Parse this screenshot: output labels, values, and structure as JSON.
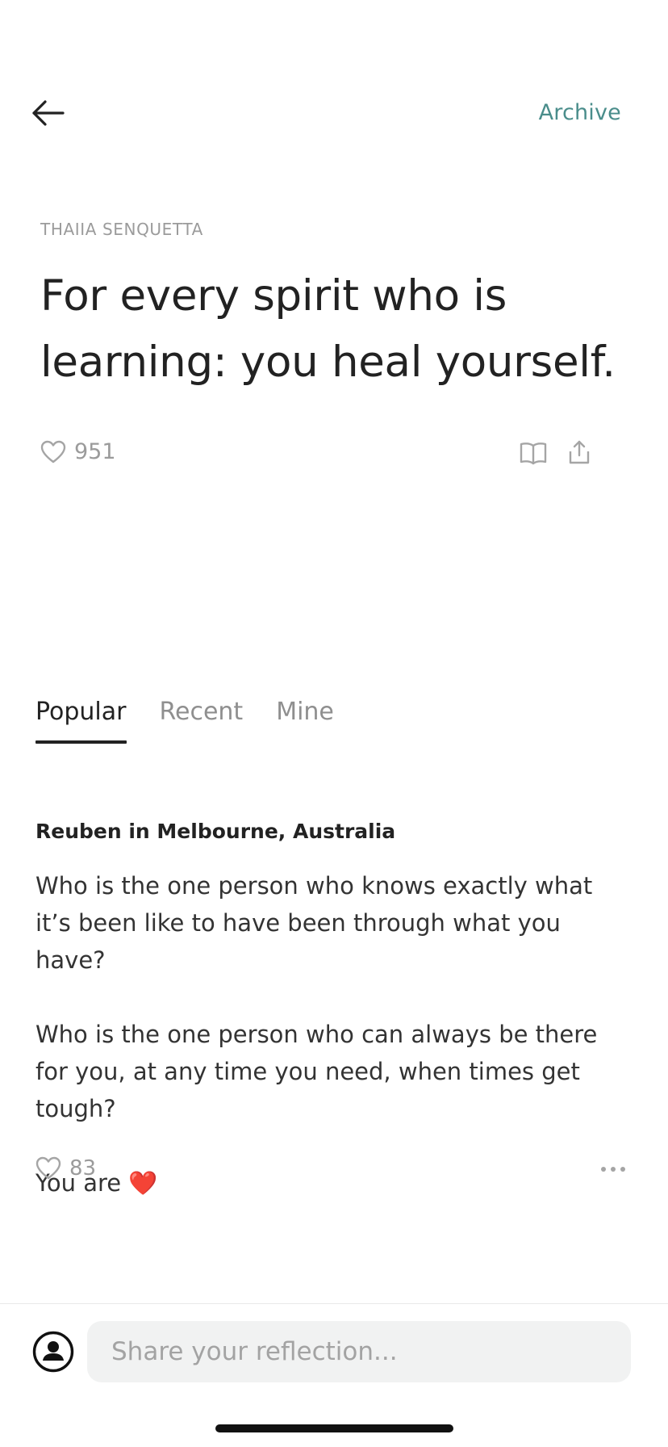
{
  "header": {
    "back_icon": "arrow-left-icon",
    "archive_label": "Archive"
  },
  "quote": {
    "author": "THAIIA SENQUETTA",
    "text": "For every spirit who is learning: you heal yourself.",
    "like_count": "951",
    "icons": [
      "heart-outline-icon",
      "book-icon",
      "share-icon"
    ]
  },
  "tabs": [
    {
      "label": "Popular",
      "active": true
    },
    {
      "label": "Recent",
      "active": false
    },
    {
      "label": "Mine",
      "active": false
    }
  ],
  "reflection": {
    "author": "Reuben in Melbourne, Australia",
    "paragraphs": [
      "Who is the one person who knows exactly what it’s been like to have been through what you have?",
      "Who is the one person who can always be there for you, at any time you need, when times get tough?",
      "You are ❤️"
    ],
    "like_count": "83",
    "more_icon": "more-horizontal-icon"
  },
  "composer": {
    "avatar_icon": "user-avatar-icon",
    "placeholder": "Share your reflection..."
  },
  "colors": {
    "accent": "#4a8d8b",
    "text": "#222222",
    "muted": "#9b9b9b",
    "input_bg": "#f1f2f2"
  }
}
